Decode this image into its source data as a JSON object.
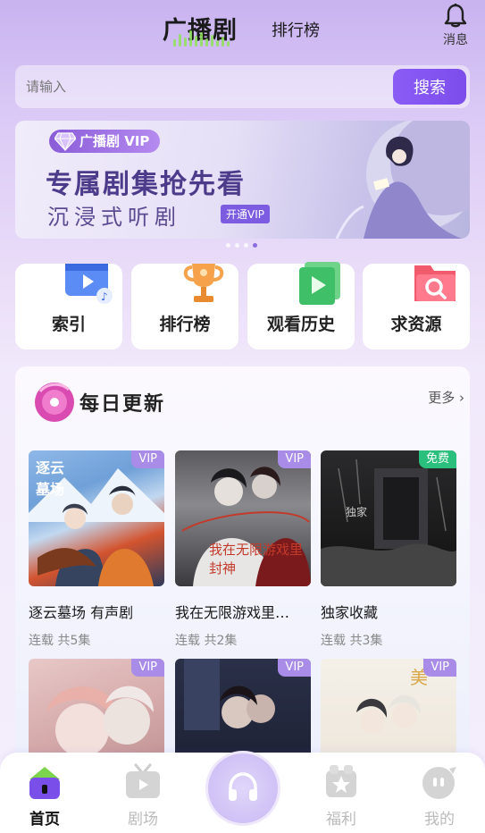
{
  "header": {
    "tab_main": "广播剧",
    "tab_rank": "排行榜",
    "message_label": "消息"
  },
  "search": {
    "placeholder": "请输入",
    "button_label": "搜索"
  },
  "banner": {
    "badge": "广播剧 VIP",
    "title": "专属剧集抢先看",
    "subtitle": "沉浸式听剧",
    "cta": "开通VIP",
    "dots_total": 4,
    "dots_active_index": 3
  },
  "quick_entries": [
    {
      "label": "索引",
      "icon": "video-index-icon"
    },
    {
      "label": "排行榜",
      "icon": "trophy-icon"
    },
    {
      "label": "观看历史",
      "icon": "history-book-icon"
    },
    {
      "label": "求资源",
      "icon": "search-folder-icon"
    }
  ],
  "daily": {
    "title": "每日更新",
    "more": "更多",
    "books": [
      {
        "title": "逐云墓场 有声剧",
        "status": "连载 共5集",
        "tag": "VIP"
      },
      {
        "title": "我在无限游戏里…",
        "status": "连载 共2集",
        "tag": "VIP"
      },
      {
        "title": "独家收藏",
        "status": "连载 共3集",
        "tag": "免费"
      },
      {
        "title": "",
        "status": "",
        "tag": "VIP"
      },
      {
        "title": "",
        "status": "",
        "tag": "VIP"
      },
      {
        "title": "",
        "status": "",
        "tag": "VIP"
      }
    ]
  },
  "bottom_nav": [
    {
      "label": "首页",
      "icon": "home-icon",
      "active": true
    },
    {
      "label": "剧场",
      "icon": "tv-icon",
      "active": false
    },
    {
      "label": "",
      "icon": "headphones-icon",
      "active": false
    },
    {
      "label": "福利",
      "icon": "gift-star-icon",
      "active": false
    },
    {
      "label": "我的",
      "icon": "profile-bubble-icon",
      "active": false
    }
  ],
  "colors": {
    "accent": "#8b5cf6",
    "vip_tag": "#a98ce8",
    "free_tag": "#2bbf7d"
  }
}
